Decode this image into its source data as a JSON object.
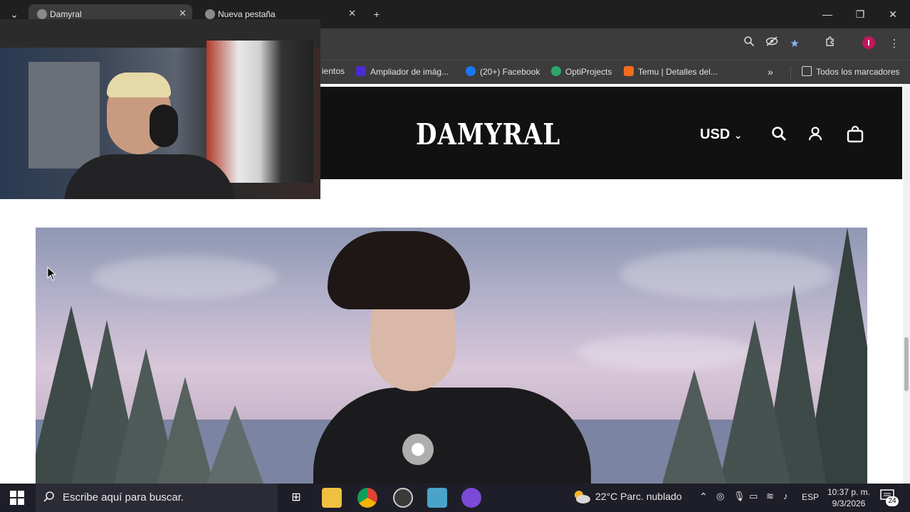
{
  "tabs": [
    {
      "title": "Damyral",
      "active": true
    },
    {
      "title": "Nueva pestaña",
      "active": false
    }
  ],
  "bookmarks": [
    {
      "label": "ientos"
    },
    {
      "label": "Ampliador de imág...",
      "icon": "y-icon",
      "color": "#4b2bd1"
    },
    {
      "label": "(20+) Facebook",
      "icon": "facebook-icon",
      "color": "#1877f2"
    },
    {
      "label": "OptiProjects",
      "icon": "opti-icon",
      "color": "#2ea56b"
    },
    {
      "label": "Temu | Detalles del...",
      "icon": "temu-icon",
      "color": "#f26b1d"
    }
  ],
  "bookmarks_all": "Todos los marcadores",
  "site": {
    "logo": "DAMYRAL",
    "currency": "USD",
    "header_bg": "#111111"
  },
  "taskbar": {
    "search_placeholder": "Escribe aquí para buscar.",
    "weather": "22°C  Parc. nublado",
    "language": "ESP",
    "time": "10:37 p. m.",
    "date": "9/3/2026",
    "notifications": "24"
  }
}
